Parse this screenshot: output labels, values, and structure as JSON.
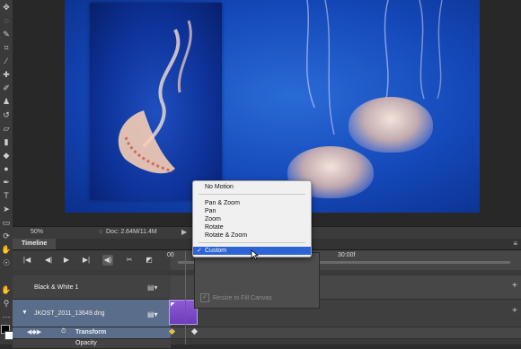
{
  "status": {
    "zoom": "50%",
    "doc_info": "Doc: 2.64M/11.4M",
    "doc_arrow": "▶"
  },
  "timeline": {
    "tab_label": "Timeline",
    "ruler_labels": [
      "00",
      "30:00f"
    ],
    "layers": [
      {
        "name": "Black & White 1"
      },
      {
        "name": "JKOST_2011_13649.dng"
      }
    ],
    "property": "Transform",
    "sub_property": "Opacity"
  },
  "motion_menu": {
    "items": [
      "No Motion",
      "Pan & Zoom",
      "Pan",
      "Zoom",
      "Rotate",
      "Rotate & Zoom",
      "Custom"
    ],
    "selected": "Custom",
    "check_mark": "✓"
  },
  "popup_panel": {
    "resize_label": "Resize to Fill Canvas"
  },
  "colors": {
    "accent_blue": "#2d63d3",
    "clip_purple": "#7a48c8",
    "playhead_red": "#e0322f"
  }
}
